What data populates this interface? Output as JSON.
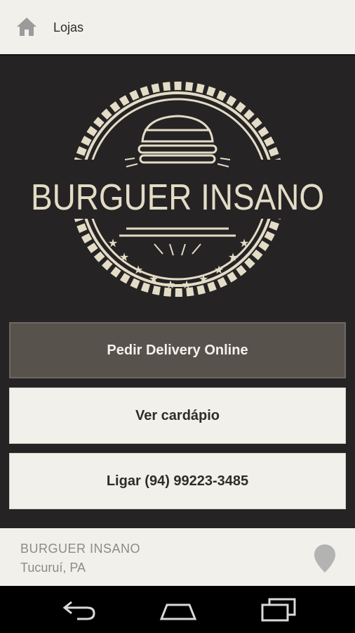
{
  "topbar": {
    "title": "Lojas",
    "home_icon": "home-icon"
  },
  "logo": {
    "brand_text": "BURGUER INSANO",
    "colors": {
      "cream": "#e3dcc6",
      "background": "#262324"
    }
  },
  "actions": {
    "delivery_label": "Pedir Delivery Online",
    "menu_label": "Ver cardápio",
    "call_label": "Ligar (94) 99223-3485"
  },
  "footer": {
    "store_name": "BURGUER INSANO",
    "location": "Tucuruí, PA",
    "pin_icon": "map-pin-icon"
  },
  "system_nav": {
    "back_icon": "back-icon",
    "home_icon": "nav-home-icon",
    "recent_icon": "recent-apps-icon"
  },
  "colors": {
    "primary_button": "#58524d",
    "light_surface": "#f2f0eb",
    "text_dark": "#2f2c2a",
    "text_muted": "#8b8b8b"
  }
}
